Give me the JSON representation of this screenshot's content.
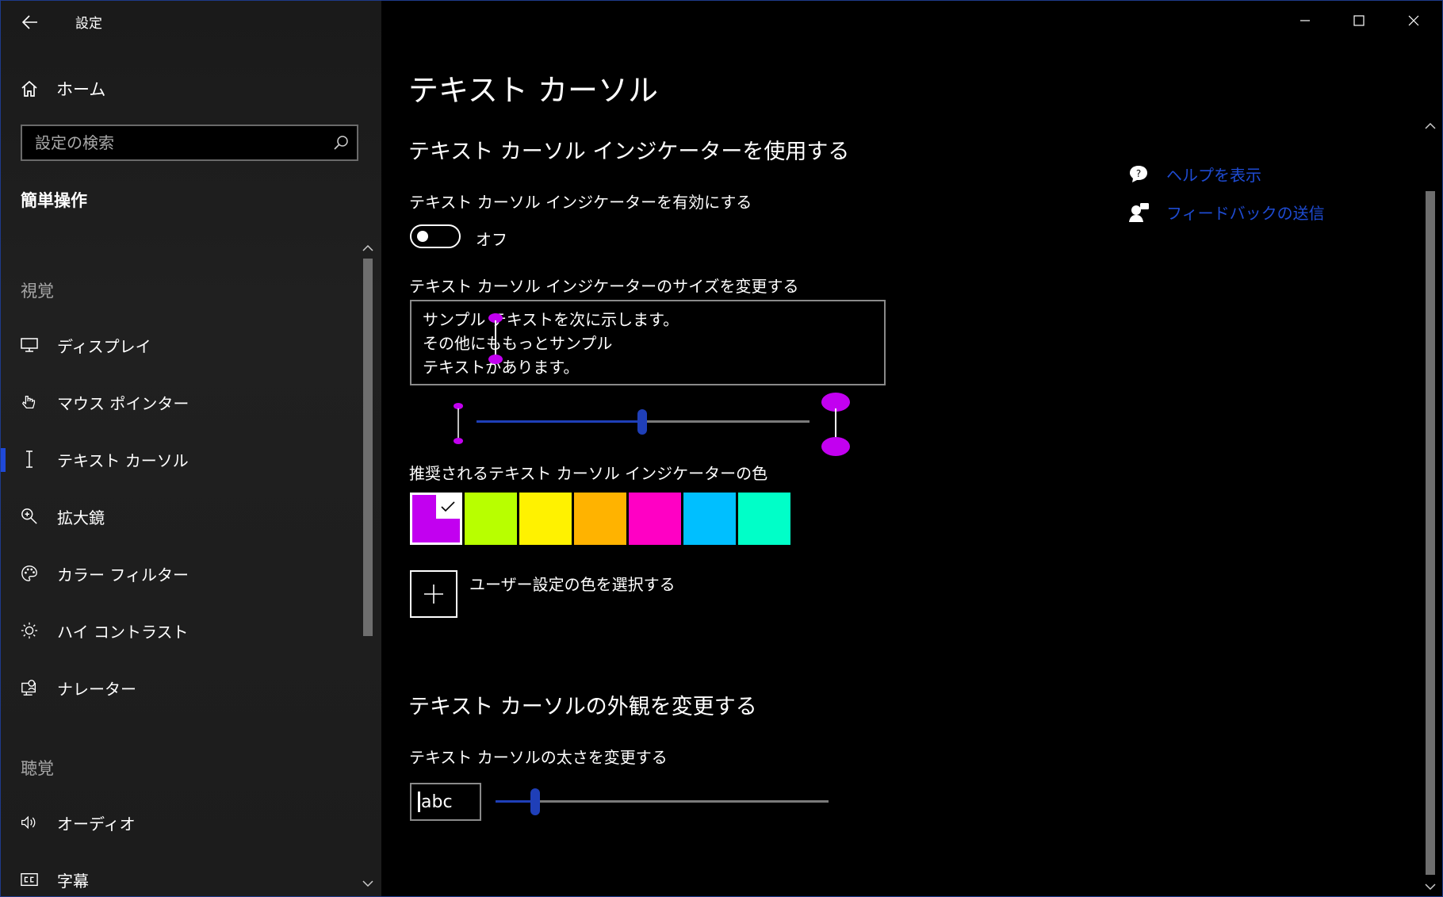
{
  "app": {
    "title": "設定"
  },
  "sidebar": {
    "home_label": "ホーム",
    "search_placeholder": "設定の検索",
    "section_title": "簡単操作",
    "groups": {
      "vision": "視覚",
      "hearing": "聴覚"
    },
    "items": [
      {
        "label": "ディスプレイ",
        "icon": "monitor-icon"
      },
      {
        "label": "マウス ポインター",
        "icon": "mouse-pointer-icon"
      },
      {
        "label": "テキスト カーソル",
        "icon": "text-cursor-icon",
        "selected": true
      },
      {
        "label": "拡大鏡",
        "icon": "magnifier-icon"
      },
      {
        "label": "カラー フィルター",
        "icon": "palette-icon"
      },
      {
        "label": "ハイ コントラスト",
        "icon": "brightness-icon"
      },
      {
        "label": "ナレーター",
        "icon": "narrator-icon"
      },
      {
        "label": "オーディオ",
        "icon": "speaker-icon"
      },
      {
        "label": "字幕",
        "icon": "closed-caption-icon"
      }
    ]
  },
  "main": {
    "page_title": "テキスト カーソル",
    "indicator_section": {
      "heading": "テキスト カーソル インジケーターを使用する",
      "enable_label": "テキスト カーソル インジケーターを有効にする",
      "toggle_state": "オフ",
      "toggle_on": false,
      "size_label": "テキスト カーソル インジケーターのサイズを変更する",
      "preview_lines": [
        "サンプル テキストを次に示します。",
        "その他にももっとサンプル",
        "テキストがあります。"
      ],
      "size_slider_value": 0.5,
      "colors_label": "推奨されるテキスト カーソル インジケーターの色",
      "colors": [
        "#c200f0",
        "#b8ff00",
        "#fff200",
        "#ffb300",
        "#ff00c4",
        "#00bfff",
        "#00ffc8"
      ],
      "selected_color_index": 0,
      "custom_color_label": "ユーザー設定の色を選択する"
    },
    "appearance_section": {
      "heading": "テキスト カーソルの外観を変更する",
      "thickness_label": "テキスト カーソルの太さを変更する",
      "preview_text": "abc",
      "thickness_slider_value": 0.12
    },
    "help": {
      "help_link": "ヘルプを表示",
      "feedback_link": "フィードバックの送信"
    }
  },
  "colors": {
    "accent": "#1f49d8",
    "link": "#1e4bd2",
    "indicator": "#c200f0"
  }
}
